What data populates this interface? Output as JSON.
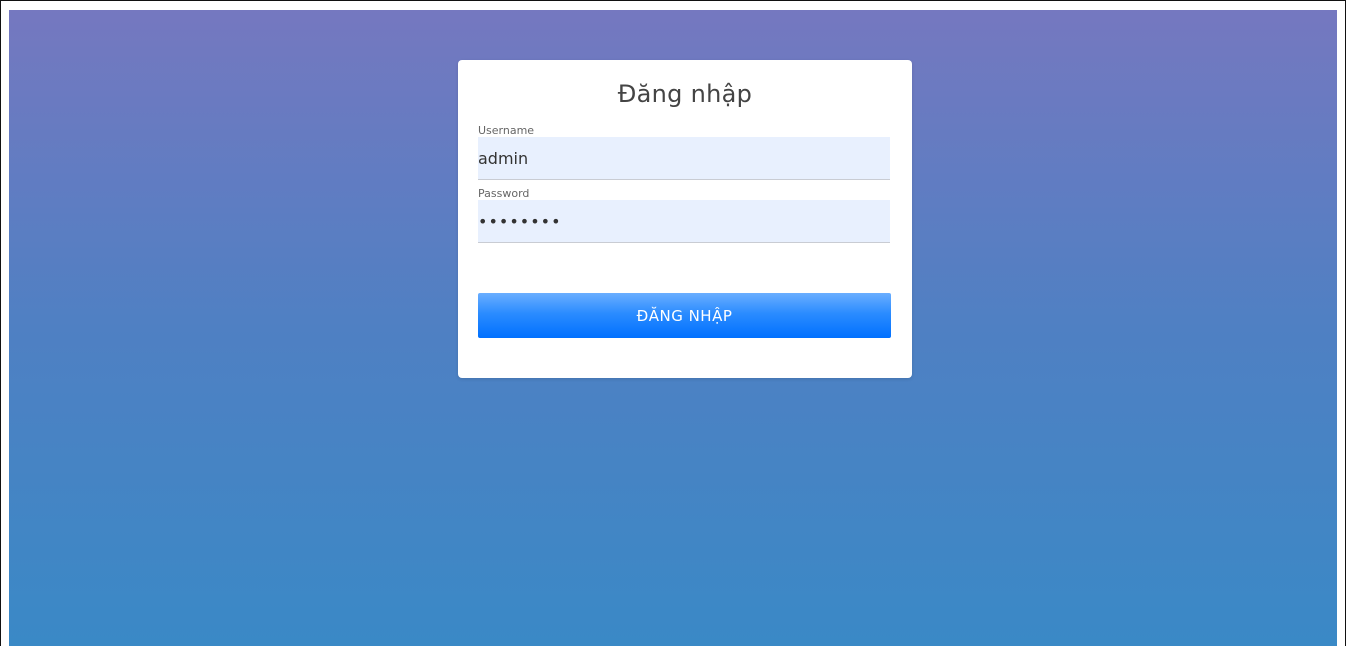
{
  "login": {
    "title": "Đăng nhập",
    "username": {
      "label": "Username",
      "value": "admin"
    },
    "password": {
      "label": "Password",
      "value": "••••••••"
    },
    "submit_label": "ĐĂNG NHẬP"
  },
  "colors": {
    "background_top": "#7578c0",
    "background_bottom": "#3a89c6",
    "button_top": "#6aaeff",
    "button_bottom": "#0070ff",
    "input_fill": "#e8f0fe"
  }
}
